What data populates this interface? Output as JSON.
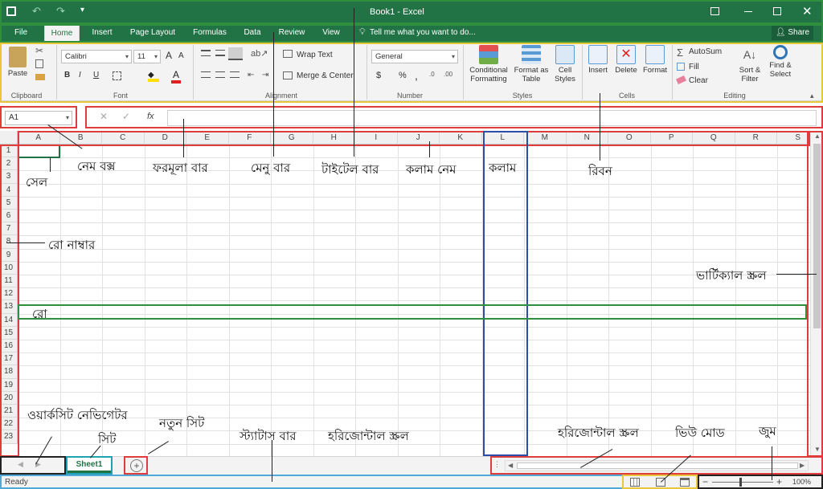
{
  "window": {
    "title": "Book1 - Excel"
  },
  "menu": {
    "file": "File",
    "tabs": [
      "Home",
      "Insert",
      "Page Layout",
      "Formulas",
      "Data",
      "Review",
      "View"
    ],
    "tell_me": "Tell me what you want to do...",
    "share": "Share"
  },
  "ribbon": {
    "clipboard": {
      "label": "Clipboard",
      "paste": "Paste"
    },
    "font": {
      "label": "Font",
      "name": "Calibri",
      "size": "11",
      "bold": "B",
      "italic": "I",
      "underline": "U",
      "grow": "A",
      "shrink": "A"
    },
    "alignment": {
      "label": "Alignment",
      "wrap": "Wrap Text",
      "merge": "Merge & Center"
    },
    "number": {
      "label": "Number",
      "format": "General",
      "currency": "$",
      "percent": "%",
      "comma": ","
    },
    "styles": {
      "label": "Styles",
      "conditional": [
        "Conditional",
        "Formatting"
      ],
      "format_table": [
        "Format as",
        "Table"
      ],
      "cell_styles": [
        "Cell",
        "Styles"
      ]
    },
    "cells": {
      "label": "Cells",
      "insert": "Insert",
      "delete": "Delete",
      "format": "Format"
    },
    "editing": {
      "label": "Editing",
      "autosum": "AutoSum",
      "fill": "Fill",
      "clear": "Clear",
      "sort": [
        "Sort &",
        "Filter"
      ],
      "find": [
        "Find &",
        "Select"
      ]
    }
  },
  "formula_bar": {
    "name_box": "A1",
    "fx": "fx",
    "value": ""
  },
  "columns": [
    "A",
    "B",
    "C",
    "D",
    "E",
    "F",
    "G",
    "H",
    "I",
    "J",
    "K",
    "L",
    "M",
    "N",
    "O",
    "P",
    "Q",
    "R",
    "S"
  ],
  "rows": [
    "1",
    "2",
    "3",
    "4",
    "5",
    "6",
    "7",
    "8",
    "9",
    "10",
    "11",
    "12",
    "13",
    "14",
    "15",
    "16",
    "17",
    "18",
    "19",
    "20",
    "21",
    "22",
    "23"
  ],
  "sheets": {
    "active": "Sheet1",
    "add": "+"
  },
  "status": {
    "text": "Ready",
    "zoom": "100%"
  },
  "annotations": {
    "name_box": "নেম বক্স",
    "formula_bar": "ফরমূলা বার",
    "menu_bar": "মেনু বার",
    "title_bar": "টাইটেল বার",
    "column_name": "কলাম নেম",
    "column": "কলাম",
    "ribbon": "রিবন",
    "cell": "সেল",
    "row_number": "রো নাম্বার",
    "row": "রো",
    "vertical_scroll": "ভার্টিক্যাল স্ক্রল",
    "worksheet_navigator": "ওয়ার্কসিট নেভিগেটর",
    "new_sheet": "নতুন সিট",
    "sheet": "সিট",
    "status_bar": "স্ট্যাটাস বার",
    "horizontal_scroll_1": "হরিজোন্টাল স্ক্রল",
    "horizontal_scroll_2": "হরিজোন্টাল স্ক্রল",
    "view_mode": "ভিউ মোড",
    "zoom": "জুম"
  }
}
